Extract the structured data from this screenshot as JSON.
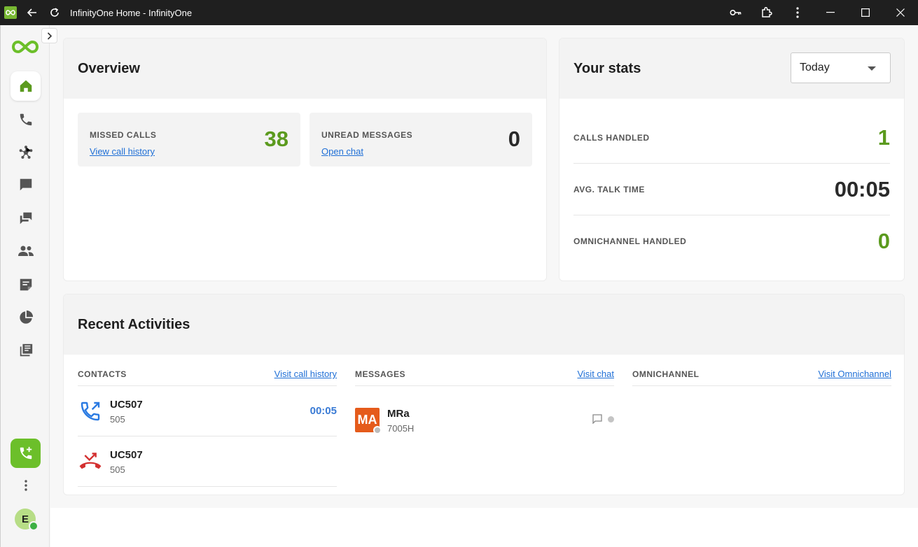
{
  "window": {
    "title": "InfinityOne Home - InfinityOne"
  },
  "overview": {
    "title": "Overview",
    "missed_calls": {
      "label": "MISSED CALLS",
      "link": "View call history",
      "value": "38"
    },
    "unread_messages": {
      "label": "UNREAD MESSAGES",
      "link": "Open chat",
      "value": "0"
    }
  },
  "stats": {
    "title": "Your stats",
    "period": "Today",
    "rows": [
      {
        "label": "CALLS HANDLED",
        "value": "1"
      },
      {
        "label": "AVG. TALK TIME",
        "value": "00:05"
      },
      {
        "label": "OMNICHANNEL HANDLED",
        "value": "0"
      }
    ]
  },
  "recent": {
    "title": "Recent Activities",
    "contacts": {
      "title": "CONTACTS",
      "link": "Visit call history",
      "items": [
        {
          "name": "UC507",
          "number": "505",
          "duration": "00:05",
          "type": "outgoing"
        },
        {
          "name": "UC507",
          "number": "505",
          "duration": "",
          "type": "missed"
        }
      ]
    },
    "messages": {
      "title": "MESSAGES",
      "link": "Visit chat",
      "items": [
        {
          "initials": "MA",
          "name": "MRa",
          "sub": "7005H"
        }
      ]
    },
    "omnichannel": {
      "title": "OMNICHANNEL",
      "link": "Visit Omnichannel"
    }
  },
  "user": {
    "initial": "E"
  },
  "colors": {
    "brand_green": "#6cbf2a",
    "value_green": "#5b9a1e",
    "link_blue": "#1f6fd6",
    "missed_red": "#d32f2f",
    "avatar_orange": "#e55b1b"
  },
  "icons": {
    "nav": [
      "home-icon",
      "phone-icon",
      "hub-icon",
      "chat-icon",
      "forum-icon",
      "people-icon",
      "notes-icon",
      "pie-chart-icon",
      "library-icon"
    ]
  }
}
